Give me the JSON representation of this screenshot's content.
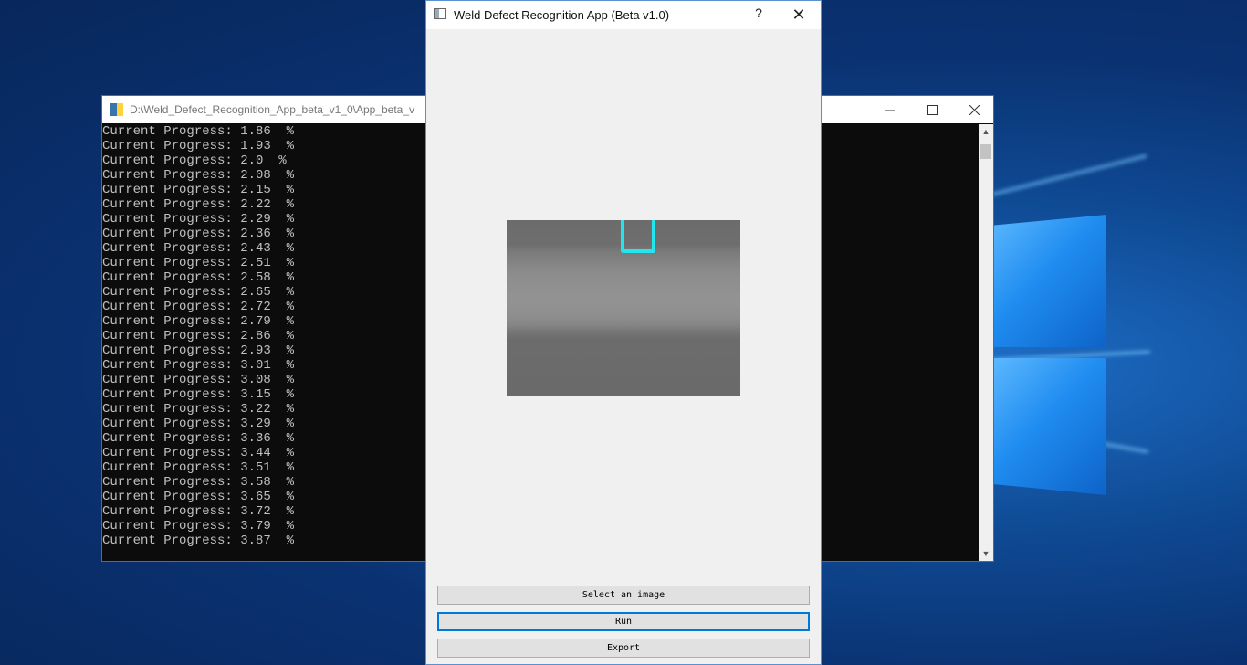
{
  "desktop": {
    "logo_icon": "windows-logo-icon"
  },
  "console": {
    "title": "D:\\Weld_Defect_Recognition_App_beta_v1_0\\App_beta_v",
    "icon": "python-icon",
    "minimize_icon": "minimize-icon",
    "maximize_icon": "maximize-icon",
    "close_icon": "close-icon",
    "lines": [
      "Current Progress: 1.86  %",
      "Current Progress: 1.93  %",
      "Current Progress: 2.0  %",
      "Current Progress: 2.08  %",
      "Current Progress: 2.15  %",
      "Current Progress: 2.22  %",
      "Current Progress: 2.29  %",
      "Current Progress: 2.36  %",
      "Current Progress: 2.43  %",
      "Current Progress: 2.51  %",
      "Current Progress: 2.58  %",
      "Current Progress: 2.65  %",
      "Current Progress: 2.72  %",
      "Current Progress: 2.79  %",
      "Current Progress: 2.86  %",
      "Current Progress: 2.93  %",
      "Current Progress: 3.01  %",
      "Current Progress: 3.08  %",
      "Current Progress: 3.15  %",
      "Current Progress: 3.22  %",
      "Current Progress: 3.29  %",
      "Current Progress: 3.36  %",
      "Current Progress: 3.44  %",
      "Current Progress: 3.51  %",
      "Current Progress: 3.58  %",
      "Current Progress: 3.65  %",
      "Current Progress: 3.72  %",
      "Current Progress: 3.79  %",
      "Current Progress: 3.87  %"
    ],
    "colors": {
      "background": "#0c0c0c",
      "text": "#c0c0c0"
    }
  },
  "dialog": {
    "title": "Weld Defect Recognition App (Beta v1.0)",
    "help_label": "?",
    "close_label": "✕",
    "buttons": {
      "select_image": "Select an image",
      "run": "Run",
      "export": "Export"
    },
    "colors": {
      "defect_box": "#22e6ee",
      "focus": "#0078d7"
    }
  }
}
